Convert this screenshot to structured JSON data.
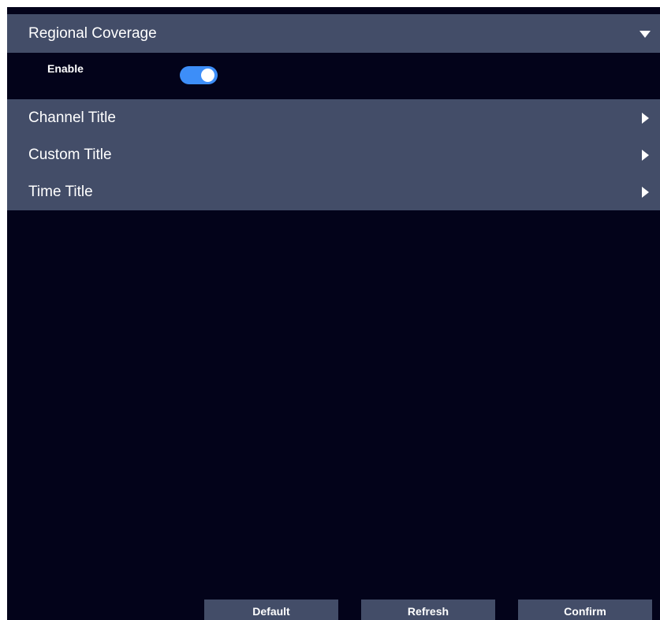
{
  "sections": {
    "regional_coverage": {
      "title": "Regional Coverage",
      "expanded": true,
      "arrow_icon": "caret-down-icon"
    },
    "channel_title": {
      "title": "Channel Title",
      "expanded": false,
      "arrow_icon": "caret-right-icon"
    },
    "custom_title": {
      "title": "Custom Title",
      "expanded": false,
      "arrow_icon": "caret-right-icon"
    },
    "time_title": {
      "title": "Time Title",
      "expanded": false,
      "arrow_icon": "caret-right-icon"
    }
  },
  "regional_coverage": {
    "enable_label": "Enable",
    "enable_value": true
  },
  "footer": {
    "default_label": "Default",
    "refresh_label": "Refresh",
    "confirm_label": "Confirm"
  },
  "colors": {
    "panel_bg": "#03031a",
    "header_bg": "#434d68",
    "toggle_on": "#3d8ef8",
    "text": "#ffffff"
  }
}
